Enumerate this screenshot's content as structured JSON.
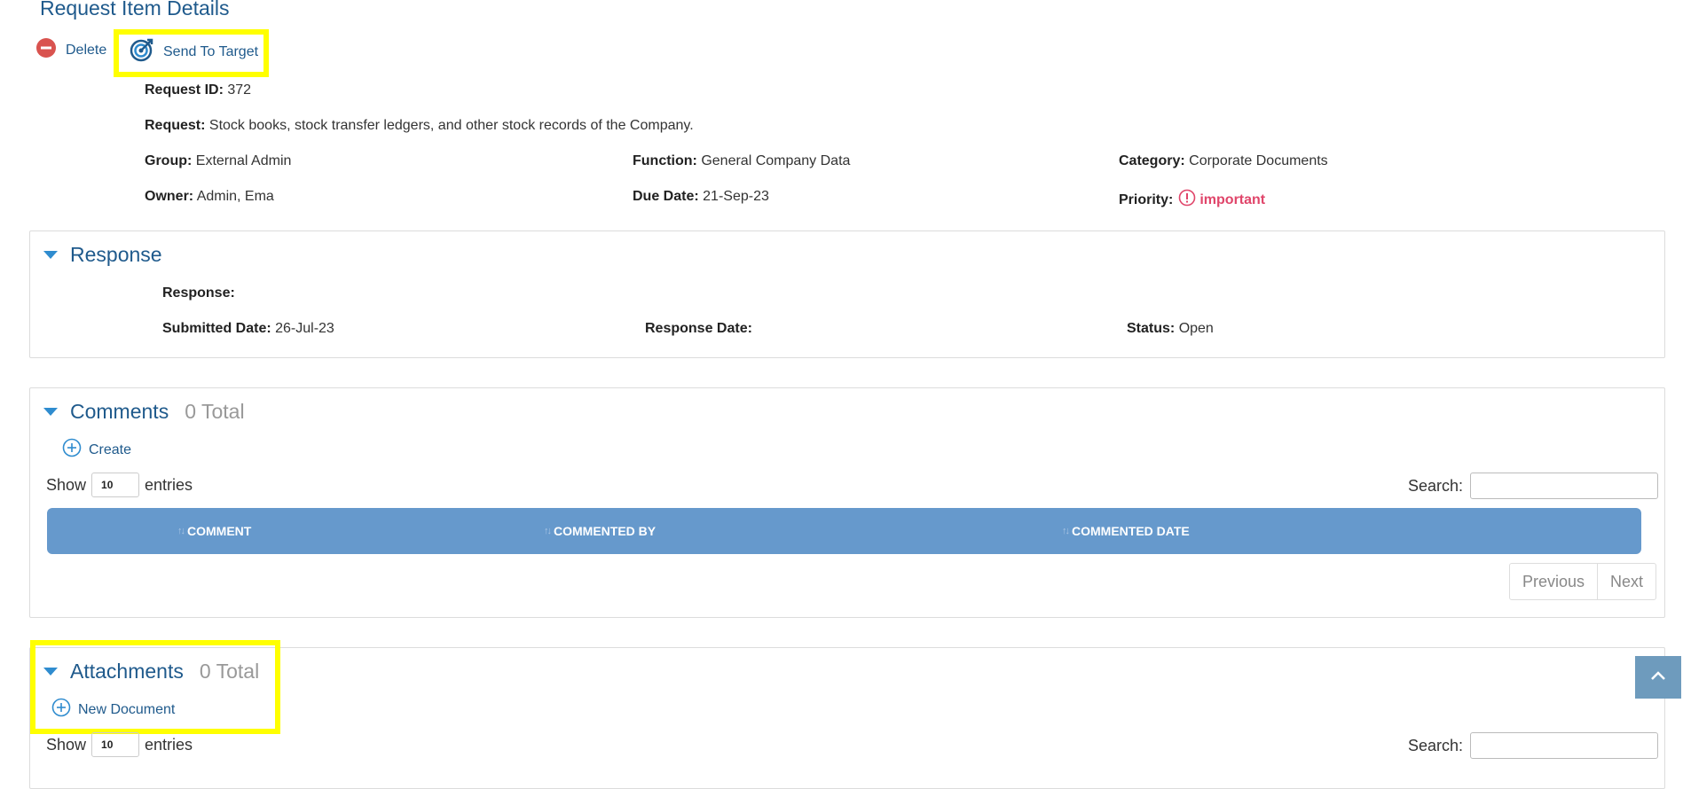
{
  "page": {
    "title": "Request Item Details"
  },
  "actions": {
    "delete_label": "Delete",
    "send_label": "Send To Target"
  },
  "details": {
    "request_id_label": "Request ID:",
    "request_id": "372",
    "request_label": "Request:",
    "request": "Stock books, stock transfer ledgers, and other stock records of the Company.",
    "group_label": "Group:",
    "group": "External Admin",
    "function_label": "Function:",
    "function": "General Company Data",
    "category_label": "Category:",
    "category": "Corporate Documents",
    "owner_label": "Owner:",
    "owner": "Admin, Ema",
    "due_label": "Due Date:",
    "due": "21-Sep-23",
    "priority_label": "Priority:",
    "priority": "important",
    "priority_color": "#e0456a"
  },
  "response": {
    "title": "Response",
    "response_label": "Response:",
    "response": "",
    "submitted_label": "Submitted Date:",
    "submitted": "26-Jul-23",
    "response_date_label": "Response Date:",
    "response_date": "",
    "status_label": "Status:",
    "status": "Open"
  },
  "comments": {
    "title": "Comments",
    "total": "0 Total",
    "create_label": "Create",
    "show_label": "Show",
    "entries_value": "10",
    "entries_label": "entries",
    "search_label": "Search:",
    "columns": [
      "COMMENT",
      "COMMENTED BY",
      "COMMENTED DATE"
    ],
    "prev_label": "Previous",
    "next_label": "Next"
  },
  "attachments": {
    "title": "Attachments",
    "total": "0 Total",
    "new_label": "New Document",
    "show_label": "Show",
    "entries_value": "10",
    "entries_label": "entries",
    "search_label": "Search:"
  },
  "colors": {
    "accent": "#1f5a8c",
    "table_header": "#6699cc",
    "highlight": "#ffff00",
    "caret": "#2f8ccf"
  }
}
